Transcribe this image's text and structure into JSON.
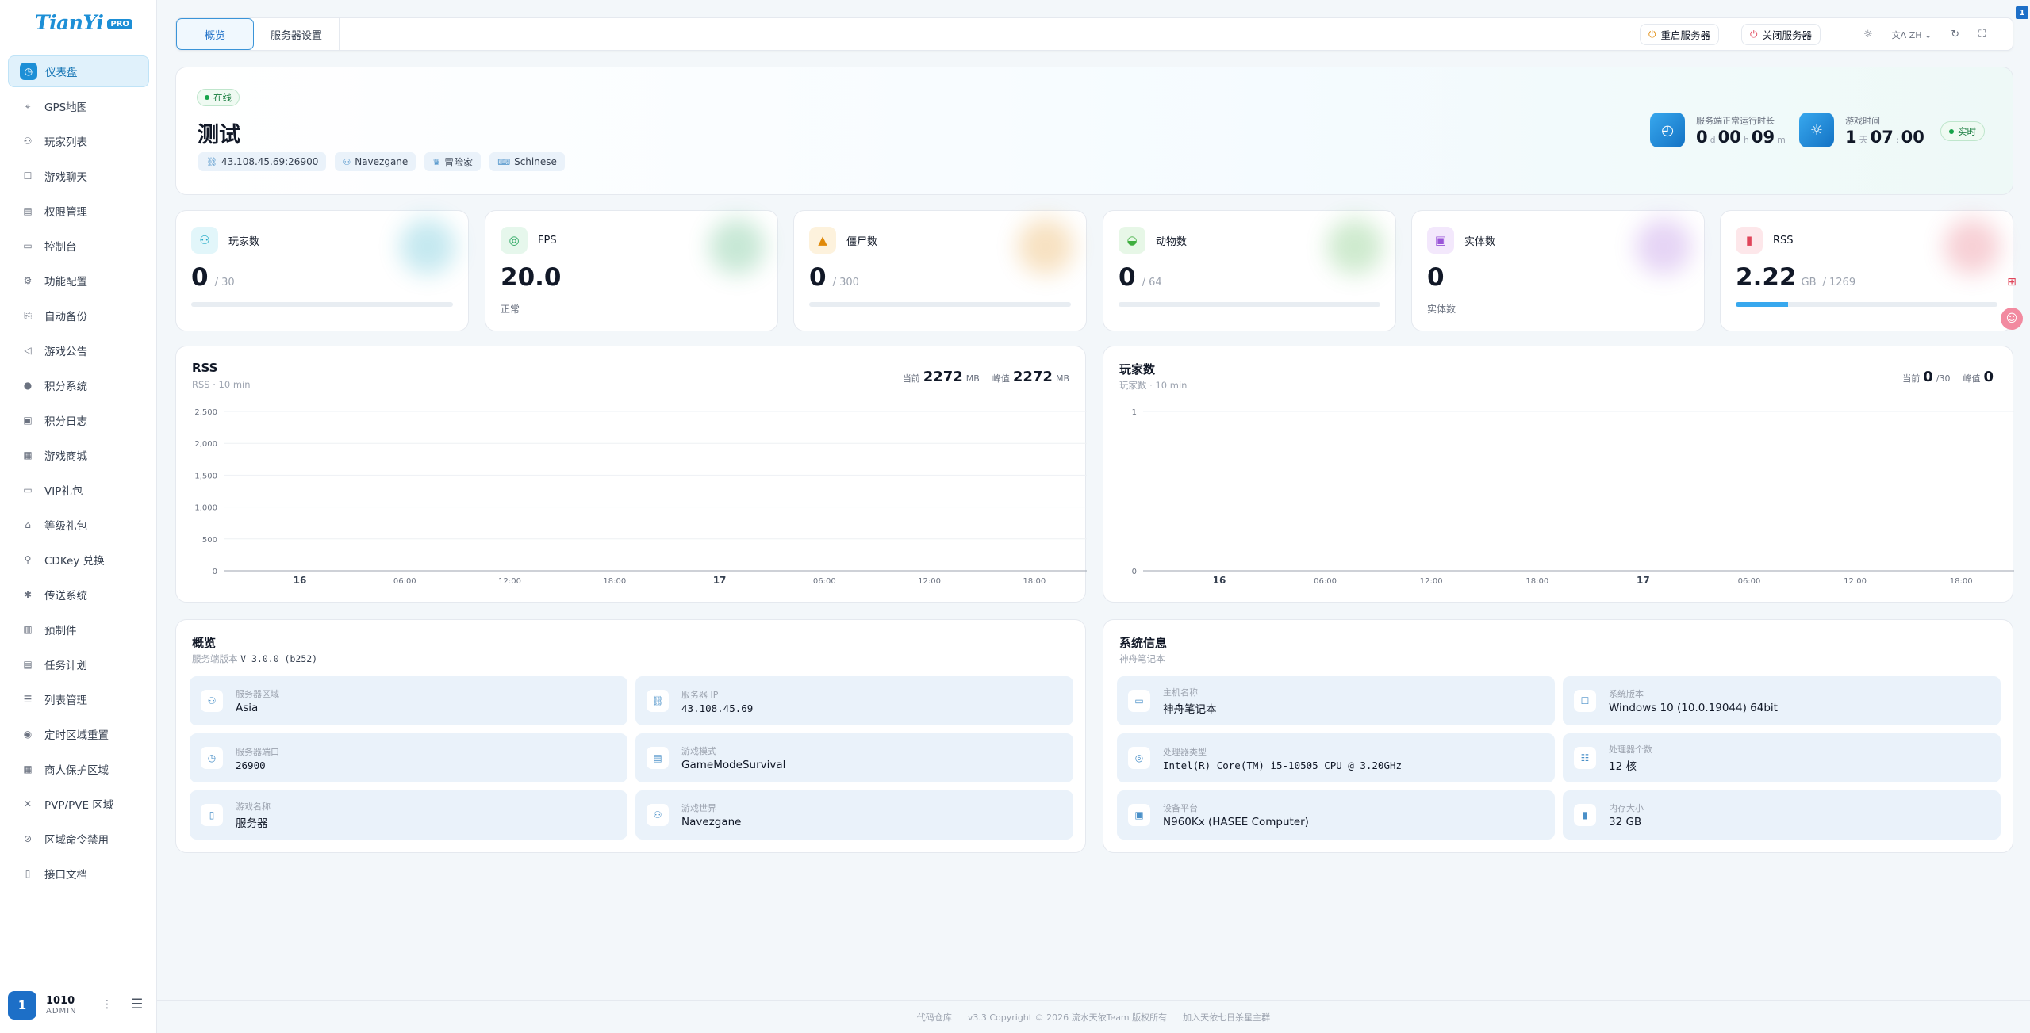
{
  "sidebar": {
    "logo": "TianYi",
    "logo_badge": "PRO",
    "items": [
      {
        "label": "仪表盘",
        "icon": "dashboard-icon",
        "glyph": "◷"
      },
      {
        "label": "GPS地图",
        "icon": "map-pin-icon",
        "glyph": "⌖"
      },
      {
        "label": "玩家列表",
        "icon": "user-icon",
        "glyph": "⚇"
      },
      {
        "label": "游戏聊天",
        "icon": "chat-icon",
        "glyph": "☐"
      },
      {
        "label": "权限管理",
        "icon": "id-card-icon",
        "glyph": "▤"
      },
      {
        "label": "控制台",
        "icon": "terminal-icon",
        "glyph": "▭"
      },
      {
        "label": "功能配置",
        "icon": "gear-icon",
        "glyph": "⚙"
      },
      {
        "label": "自动备份",
        "icon": "backup-icon",
        "glyph": "⎘"
      },
      {
        "label": "游戏公告",
        "icon": "megaphone-icon",
        "glyph": "◁"
      },
      {
        "label": "积分系统",
        "icon": "coin-icon",
        "glyph": "●"
      },
      {
        "label": "积分日志",
        "icon": "log-icon",
        "glyph": "▣"
      },
      {
        "label": "游戏商城",
        "icon": "store-icon",
        "glyph": "▦"
      },
      {
        "label": "VIP礼包",
        "icon": "vip-icon",
        "glyph": "▭"
      },
      {
        "label": "等级礼包",
        "icon": "gift-icon",
        "glyph": "⌂"
      },
      {
        "label": "CDKey 兑换",
        "icon": "key-icon",
        "glyph": "⚲"
      },
      {
        "label": "传送系统",
        "icon": "teleport-icon",
        "glyph": "✱"
      },
      {
        "label": "预制件",
        "icon": "building-icon",
        "glyph": "▥"
      },
      {
        "label": "任务计划",
        "icon": "calendar-icon",
        "glyph": "▤"
      },
      {
        "label": "列表管理",
        "icon": "list-icon",
        "glyph": "☰"
      },
      {
        "label": "定时区域重置",
        "icon": "location-icon",
        "glyph": "◉"
      },
      {
        "label": "商人保护区域",
        "icon": "shop-icon",
        "glyph": "▦"
      },
      {
        "label": "PVP/PVE 区域",
        "icon": "swords-icon",
        "glyph": "✕"
      },
      {
        "label": "区域命令禁用",
        "icon": "ban-icon",
        "glyph": "⊘"
      },
      {
        "label": "接口文档",
        "icon": "doc-icon",
        "glyph": "▯"
      }
    ],
    "user": {
      "avatar": "1",
      "name": "1010",
      "role": "ADMIN"
    }
  },
  "topbar": {
    "tabs": [
      "概览",
      "服务器设置"
    ],
    "restart_label": "重启服务器",
    "shutdown_label": "关闭服务器",
    "lang": "ZH",
    "corner_badge": "1"
  },
  "hero": {
    "status": "在线",
    "title": "测试",
    "chips": [
      {
        "icon": "link-icon",
        "glyph": "⛓",
        "text": "43.108.45.69:26900"
      },
      {
        "icon": "user-icon",
        "glyph": "⚇",
        "text": "Navezgane"
      },
      {
        "icon": "trophy-icon",
        "glyph": "♛",
        "text": "冒险家"
      },
      {
        "icon": "language-icon",
        "glyph": "⌨",
        "text": "Schinese"
      }
    ],
    "uptime": {
      "label": "服务端正常运行时长",
      "d": "0",
      "d_unit": "d",
      "h": "00",
      "h_unit": "h",
      "m": "09",
      "m_unit": "m"
    },
    "gametime": {
      "label": "游戏时间",
      "day": "1",
      "day_unit": "天",
      "hour": "07",
      "sep": ":",
      "minute": "00"
    },
    "realtime": "实时"
  },
  "stats": [
    {
      "label": "玩家数",
      "value": "0",
      "sub": "/ 30",
      "note": "",
      "fill": 0,
      "color": "#1aa7c4",
      "bg": "#e2f6fa",
      "glyph": "⚇",
      "icon": "user-icon"
    },
    {
      "label": "FPS",
      "value": "20.0",
      "sub": "",
      "note": "正常",
      "fill": null,
      "color": "#22a35a",
      "bg": "#e6f7ec",
      "glyph": "◎",
      "icon": "chip-icon"
    },
    {
      "label": "僵尸数",
      "value": "0",
      "sub": "/ 300",
      "note": "",
      "fill": 0,
      "color": "#e08a0b",
      "bg": "#fdf2dd",
      "glyph": "▲",
      "icon": "warning-icon"
    },
    {
      "label": "动物数",
      "value": "0",
      "sub": "/ 64",
      "note": "",
      "fill": 0,
      "color": "#3fae3f",
      "bg": "#e7f7e7",
      "glyph": "◒",
      "icon": "bell-icon"
    },
    {
      "label": "实体数",
      "value": "0",
      "sub": "",
      "note": "实体数",
      "fill": null,
      "color": "#9a55d8",
      "bg": "#f3e8fc",
      "glyph": "▣",
      "icon": "box-icon"
    },
    {
      "label": "RSS",
      "value": "2.22",
      "unit": "GB",
      "sub": "/ 1269",
      "note": "",
      "fill": 0.2,
      "color": "#e0455a",
      "bg": "#fde7ea",
      "glyph": "▮",
      "icon": "bar-chart-icon"
    }
  ],
  "chart_data": [
    {
      "type": "line",
      "title": "RSS",
      "subtitle": "RSS · 10 min",
      "current_label": "当前",
      "current_value": "2272",
      "current_unit": "MB",
      "peak_label": "峰值",
      "peak_value": "2272",
      "peak_unit": "MB",
      "ylim": [
        0,
        2500
      ],
      "yticks": [
        "0",
        "500",
        "1,000",
        "1,500",
        "2,000",
        "2,500"
      ],
      "xticks": [
        "16",
        "06:00",
        "12:00",
        "18:00",
        "17",
        "06:00",
        "12:00",
        "18:00"
      ],
      "series": []
    },
    {
      "type": "line",
      "title": "玩家数",
      "subtitle": "玩家数 · 10 min",
      "current_label": "当前",
      "current_value": "0",
      "current_unit": "/30",
      "peak_label": "峰值",
      "peak_value": "0",
      "peak_unit": "",
      "ylim": [
        0,
        1
      ],
      "yticks": [
        "0",
        "1"
      ],
      "xticks": [
        "16",
        "06:00",
        "12:00",
        "18:00",
        "17",
        "06:00",
        "12:00",
        "18:00"
      ],
      "series": []
    }
  ],
  "overview": {
    "title": "概览",
    "sub_label": "服务端版本",
    "version": "V 3.0.0 (b252)",
    "items": [
      {
        "label": "服务器区域",
        "value": "Asia",
        "glyph": "⚇",
        "icon": "region-icon",
        "mono": false
      },
      {
        "label": "服务器 IP",
        "value": "43.108.45.69",
        "glyph": "⛓",
        "icon": "ip-icon",
        "mono": true
      },
      {
        "label": "服务器端口",
        "value": "26900",
        "glyph": "◷",
        "icon": "port-icon",
        "mono": true
      },
      {
        "label": "游戏模式",
        "value": "GameModeSurvival",
        "glyph": "▤",
        "icon": "mode-icon",
        "mono": false
      },
      {
        "label": "游戏名称",
        "value": "服务器",
        "glyph": "▯",
        "icon": "name-icon",
        "mono": false
      },
      {
        "label": "游戏世界",
        "value": "Navezgane",
        "glyph": "⚇",
        "icon": "world-icon",
        "mono": false
      }
    ]
  },
  "sysinfo": {
    "title": "系统信息",
    "subtitle": "神舟笔记本",
    "items": [
      {
        "label": "主机名称",
        "value": "神舟笔记本",
        "glyph": "▭",
        "icon": "monitor-icon",
        "mono": false
      },
      {
        "label": "系统版本",
        "value": "Windows 10 (10.0.19044) 64bit",
        "glyph": "☐",
        "icon": "os-icon",
        "mono": false
      },
      {
        "label": "处理器类型",
        "value": "Intel(R) Core(TM) i5-10505 CPU @ 3.20GHz",
        "glyph": "◎",
        "icon": "cpu-icon",
        "mono": true
      },
      {
        "label": "处理器个数",
        "value": "12 核",
        "glyph": "☷",
        "icon": "cores-icon",
        "mono": false
      },
      {
        "label": "设备平台",
        "value": "N960Kx (HASEE Computer)",
        "glyph": "▣",
        "icon": "platform-icon",
        "mono": false
      },
      {
        "label": "内存大小",
        "value": "32 GB",
        "glyph": "▮",
        "icon": "memory-icon",
        "mono": false
      }
    ]
  },
  "footer": {
    "repo": "代码仓库",
    "copyright": "v3.3 Copyright © 2026 流水天依Team 版权所有",
    "group": "加入天依七日杀星主群"
  }
}
